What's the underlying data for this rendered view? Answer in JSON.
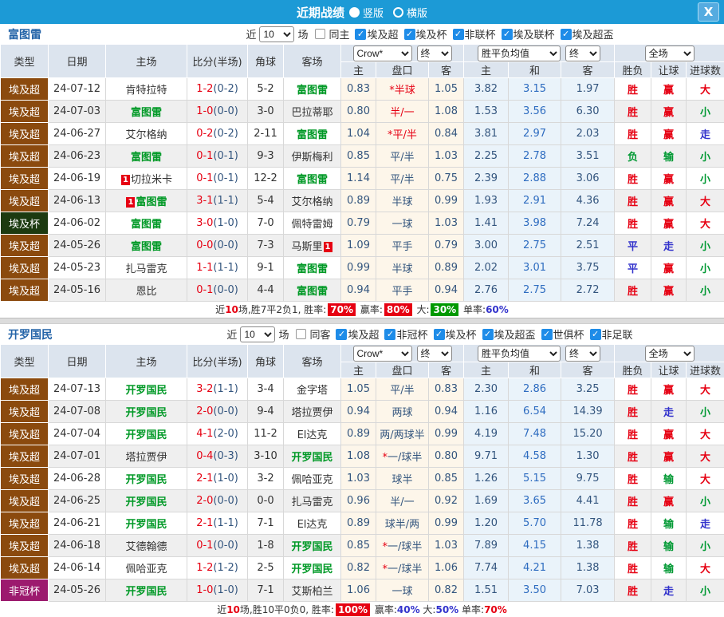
{
  "titlebar": {
    "title": "近期战绩",
    "radio_vertical": "竖版",
    "radio_horizontal": "横版",
    "close_label": "X"
  },
  "colors": {
    "titlebar_blue": "#1c9ad6",
    "type_league_brown": "#8b4a0e",
    "type_cup_darkgreen": "#1c3a10",
    "type_cup_purple": "#9c1a6e",
    "win_red": "#e60012",
    "lose_green": "#009933",
    "draw_blue": "#3333cc",
    "focus_team_green": "#009926",
    "odds_navy": "#33557e",
    "avg_draw_blue": "#2e6cc0"
  },
  "sections": [
    {
      "team": "富图雷",
      "filters": {
        "near": "近",
        "count": "10",
        "games": "场",
        "same_label": "同主",
        "same_checked": false,
        "leagues": [
          "埃及超",
          "埃及杯",
          "非联杯",
          "埃及联杯",
          "埃及超盃"
        ]
      },
      "header": {
        "cols": [
          "类型",
          "日期",
          "主场",
          "比分(半场)",
          "角球",
          "客场"
        ],
        "crow_select": "Crow*",
        "final_select1": "终",
        "avg_select": "胜平负均值",
        "final_select2": "终",
        "full_select": "全场",
        "sub_cols": [
          "主",
          "盘口",
          "客",
          "主",
          "和",
          "客",
          "胜负",
          "让球",
          "进球数"
        ]
      },
      "rows": [
        {
          "type": "埃及超",
          "type_color": "brown",
          "date": "24-07-12",
          "home": "肯特拉特",
          "home_green": false,
          "home_badge": "",
          "score": "1-2",
          "half": "(0-2)",
          "corner": "5-2",
          "away": "富图雷",
          "away_green": true,
          "away_badge": "",
          "crow_home": "0.83",
          "hcp_star": true,
          "hcp": "半球",
          "hcp_color": "red",
          "crow_away": "1.05",
          "avg_home": "3.82",
          "avg_draw": "3.15",
          "avg_away": "1.97",
          "res": "胜",
          "res_color": "red",
          "let": "赢",
          "let_color": "red",
          "goal": "大",
          "goal_color": "red"
        },
        {
          "type": "埃及超",
          "type_color": "brown",
          "date": "24-07-03",
          "home": "富图雷",
          "home_green": true,
          "home_badge": "",
          "score": "1-0",
          "half": "(0-0)",
          "corner": "3-0",
          "away": "巴拉蒂耶",
          "away_green": false,
          "away_badge": "",
          "crow_home": "0.80",
          "hcp_star": false,
          "hcp": "半/一",
          "hcp_color": "red",
          "crow_away": "1.08",
          "avg_home": "1.53",
          "avg_draw": "3.56",
          "avg_away": "6.30",
          "res": "胜",
          "res_color": "red",
          "let": "赢",
          "let_color": "red",
          "goal": "小",
          "goal_color": "green"
        },
        {
          "type": "埃及超",
          "type_color": "brown",
          "date": "24-06-27",
          "home": "艾尔格纳",
          "home_green": false,
          "home_badge": "",
          "score": "0-2",
          "half": "(0-2)",
          "corner": "2-11",
          "away": "富图雷",
          "away_green": true,
          "away_badge": "",
          "crow_home": "1.04",
          "hcp_star": true,
          "hcp": "平/半",
          "hcp_color": "red",
          "crow_away": "0.84",
          "avg_home": "3.81",
          "avg_draw": "2.97",
          "avg_away": "2.03",
          "res": "胜",
          "res_color": "red",
          "let": "赢",
          "let_color": "red",
          "goal": "走",
          "goal_color": "blue"
        },
        {
          "type": "埃及超",
          "type_color": "brown",
          "date": "24-06-23",
          "home": "富图雷",
          "home_green": true,
          "home_badge": "",
          "score": "0-1",
          "half": "(0-1)",
          "corner": "9-3",
          "away": "伊斯梅利",
          "away_green": false,
          "away_badge": "",
          "crow_home": "0.85",
          "hcp_star": false,
          "hcp": "平/半",
          "hcp_color": "navy",
          "crow_away": "1.03",
          "avg_home": "2.25",
          "avg_draw": "2.78",
          "avg_away": "3.51",
          "res": "负",
          "res_color": "green",
          "let": "输",
          "let_color": "green",
          "goal": "小",
          "goal_color": "green"
        },
        {
          "type": "埃及超",
          "type_color": "brown",
          "date": "24-06-19",
          "home": "切拉米卡",
          "home_green": false,
          "home_badge": "pre",
          "score": "0-1",
          "half": "(0-1)",
          "corner": "12-2",
          "away": "富图雷",
          "away_green": true,
          "away_badge": "",
          "crow_home": "1.14",
          "hcp_star": false,
          "hcp": "平/半",
          "hcp_color": "navy",
          "crow_away": "0.75",
          "avg_home": "2.39",
          "avg_draw": "2.88",
          "avg_away": "3.06",
          "res": "胜",
          "res_color": "red",
          "let": "赢",
          "let_color": "red",
          "goal": "小",
          "goal_color": "green"
        },
        {
          "type": "埃及超",
          "type_color": "brown",
          "date": "24-06-13",
          "home": "富图雷",
          "home_green": true,
          "home_badge": "pre",
          "score": "3-1",
          "half": "(1-1)",
          "corner": "5-4",
          "away": "艾尔格纳",
          "away_green": false,
          "away_badge": "",
          "crow_home": "0.89",
          "hcp_star": false,
          "hcp": "半球",
          "hcp_color": "navy",
          "crow_away": "0.99",
          "avg_home": "1.93",
          "avg_draw": "2.91",
          "avg_away": "4.36",
          "res": "胜",
          "res_color": "red",
          "let": "赢",
          "let_color": "red",
          "goal": "大",
          "goal_color": "red"
        },
        {
          "type": "埃及杯",
          "type_color": "darkgreen",
          "date": "24-06-02",
          "home": "富图雷",
          "home_green": true,
          "home_badge": "",
          "score": "3-0",
          "half": "(1-0)",
          "corner": "7-0",
          "away": "佩特雷姆",
          "away_green": false,
          "away_badge": "",
          "crow_home": "0.79",
          "hcp_star": false,
          "hcp": "一球",
          "hcp_color": "navy",
          "crow_away": "1.03",
          "avg_home": "1.41",
          "avg_draw": "3.98",
          "avg_away": "7.24",
          "res": "胜",
          "res_color": "red",
          "let": "赢",
          "let_color": "red",
          "goal": "大",
          "goal_color": "red"
        },
        {
          "type": "埃及超",
          "type_color": "brown",
          "date": "24-05-26",
          "home": "富图雷",
          "home_green": true,
          "home_badge": "",
          "score": "0-0",
          "half": "(0-0)",
          "corner": "7-3",
          "away": "马斯里",
          "away_green": false,
          "away_badge": "post",
          "crow_home": "1.09",
          "hcp_star": false,
          "hcp": "平手",
          "hcp_color": "navy",
          "crow_away": "0.79",
          "avg_home": "3.00",
          "avg_draw": "2.75",
          "avg_away": "2.51",
          "res": "平",
          "res_color": "blue",
          "let": "走",
          "let_color": "blue",
          "goal": "小",
          "goal_color": "green"
        },
        {
          "type": "埃及超",
          "type_color": "brown",
          "date": "24-05-23",
          "home": "扎马雷克",
          "home_green": false,
          "home_badge": "",
          "score": "1-1",
          "half": "(1-1)",
          "corner": "9-1",
          "away": "富图雷",
          "away_green": true,
          "away_badge": "",
          "crow_home": "0.99",
          "hcp_star": false,
          "hcp": "半球",
          "hcp_color": "navy",
          "crow_away": "0.89",
          "avg_home": "2.02",
          "avg_draw": "3.01",
          "avg_away": "3.75",
          "res": "平",
          "res_color": "blue",
          "let": "赢",
          "let_color": "red",
          "goal": "小",
          "goal_color": "green"
        },
        {
          "type": "埃及超",
          "type_color": "brown",
          "date": "24-05-16",
          "home": "恩比",
          "home_green": false,
          "home_badge": "",
          "score": "0-1",
          "half": "(0-0)",
          "corner": "4-4",
          "away": "富图雷",
          "away_green": true,
          "away_badge": "",
          "crow_home": "0.94",
          "hcp_star": false,
          "hcp": "平手",
          "hcp_color": "navy",
          "crow_away": "0.94",
          "avg_home": "2.76",
          "avg_draw": "2.75",
          "avg_away": "2.72",
          "res": "胜",
          "res_color": "red",
          "let": "赢",
          "let_color": "red",
          "goal": "小",
          "goal_color": "green"
        }
      ],
      "summary": [
        {
          "t": "近",
          "s": "plain"
        },
        {
          "t": "10",
          "s": "red-text"
        },
        {
          "t": "场,胜7平2负1, 胜率:",
          "s": "plain"
        },
        {
          "t": "70%",
          "s": "red-badge"
        },
        {
          "t": " 赢率:",
          "s": "plain"
        },
        {
          "t": "80%",
          "s": "red-badge"
        },
        {
          "t": " 大:",
          "s": "plain"
        },
        {
          "t": "30%",
          "s": "green-badge"
        },
        {
          "t": " 单率:",
          "s": "plain"
        },
        {
          "t": "60%",
          "s": "blue-text"
        }
      ]
    },
    {
      "team": "开罗国民",
      "filters": {
        "near": "近",
        "count": "10",
        "games": "场",
        "same_label": "同客",
        "same_checked": false,
        "leagues": [
          "埃及超",
          "非冠杯",
          "埃及杯",
          "埃及超盃",
          "世俱杯",
          "非足联"
        ]
      },
      "header": {
        "cols": [
          "类型",
          "日期",
          "主场",
          "比分(半场)",
          "角球",
          "客场"
        ],
        "crow_select": "Crow*",
        "final_select1": "终",
        "avg_select": "胜平负均值",
        "final_select2": "终",
        "full_select": "全场",
        "sub_cols": [
          "主",
          "盘口",
          "客",
          "主",
          "和",
          "客",
          "胜负",
          "让球",
          "进球数"
        ]
      },
      "rows": [
        {
          "type": "埃及超",
          "type_color": "brown",
          "date": "24-07-13",
          "home": "开罗国民",
          "home_green": true,
          "home_badge": "",
          "score": "3-2",
          "half": "(1-1)",
          "corner": "3-4",
          "away": "金字塔",
          "away_green": false,
          "away_badge": "",
          "crow_home": "1.05",
          "hcp_star": false,
          "hcp": "平/半",
          "hcp_color": "navy",
          "crow_away": "0.83",
          "avg_home": "2.30",
          "avg_draw": "2.86",
          "avg_away": "3.25",
          "res": "胜",
          "res_color": "red",
          "let": "赢",
          "let_color": "red",
          "goal": "大",
          "goal_color": "red"
        },
        {
          "type": "埃及超",
          "type_color": "brown",
          "date": "24-07-08",
          "home": "开罗国民",
          "home_green": true,
          "home_badge": "",
          "score": "2-0",
          "half": "(0-0)",
          "corner": "9-4",
          "away": "塔拉贾伊",
          "away_green": false,
          "away_badge": "",
          "crow_home": "0.94",
          "hcp_star": false,
          "hcp": "两球",
          "hcp_color": "navy",
          "crow_away": "0.94",
          "avg_home": "1.16",
          "avg_draw": "6.54",
          "avg_away": "14.39",
          "res": "胜",
          "res_color": "red",
          "let": "走",
          "let_color": "blue",
          "goal": "小",
          "goal_color": "green"
        },
        {
          "type": "埃及超",
          "type_color": "brown",
          "date": "24-07-04",
          "home": "开罗国民",
          "home_green": true,
          "home_badge": "",
          "score": "4-1",
          "half": "(2-0)",
          "corner": "11-2",
          "away": "El达克",
          "away_green": false,
          "away_badge": "",
          "crow_home": "0.89",
          "hcp_star": false,
          "hcp": "两/两球半",
          "hcp_color": "navy",
          "crow_away": "0.99",
          "avg_home": "4.19",
          "avg_draw": "7.48",
          "avg_away": "15.20",
          "res": "胜",
          "res_color": "red",
          "let": "赢",
          "let_color": "red",
          "goal": "大",
          "goal_color": "red"
        },
        {
          "type": "埃及超",
          "type_color": "brown",
          "date": "24-07-01",
          "home": "塔拉贾伊",
          "home_green": false,
          "home_badge": "",
          "score": "0-4",
          "half": "(0-3)",
          "corner": "3-10",
          "away": "开罗国民",
          "away_green": true,
          "away_badge": "",
          "crow_home": "1.08",
          "hcp_star": true,
          "hcp": "一/球半",
          "hcp_color": "navy",
          "crow_away": "0.80",
          "avg_home": "9.71",
          "avg_draw": "4.58",
          "avg_away": "1.30",
          "res": "胜",
          "res_color": "red",
          "let": "赢",
          "let_color": "red",
          "goal": "大",
          "goal_color": "red"
        },
        {
          "type": "埃及超",
          "type_color": "brown",
          "date": "24-06-28",
          "home": "开罗国民",
          "home_green": true,
          "home_badge": "",
          "score": "2-1",
          "half": "(1-0)",
          "corner": "3-2",
          "away": "佩哈亚克",
          "away_green": false,
          "away_badge": "",
          "crow_home": "1.03",
          "hcp_star": false,
          "hcp": "球半",
          "hcp_color": "navy",
          "crow_away": "0.85",
          "avg_home": "1.26",
          "avg_draw": "5.15",
          "avg_away": "9.75",
          "res": "胜",
          "res_color": "red",
          "let": "输",
          "let_color": "green",
          "goal": "大",
          "goal_color": "red"
        },
        {
          "type": "埃及超",
          "type_color": "brown",
          "date": "24-06-25",
          "home": "开罗国民",
          "home_green": true,
          "home_badge": "",
          "score": "2-0",
          "half": "(0-0)",
          "corner": "0-0",
          "away": "扎马雷克",
          "away_green": false,
          "away_badge": "",
          "crow_home": "0.96",
          "hcp_star": false,
          "hcp": "半/一",
          "hcp_color": "navy",
          "crow_away": "0.92",
          "avg_home": "1.69",
          "avg_draw": "3.65",
          "avg_away": "4.41",
          "res": "胜",
          "res_color": "red",
          "let": "赢",
          "let_color": "red",
          "goal": "小",
          "goal_color": "green"
        },
        {
          "type": "埃及超",
          "type_color": "brown",
          "date": "24-06-21",
          "home": "开罗国民",
          "home_green": true,
          "home_badge": "",
          "score": "2-1",
          "half": "(1-1)",
          "corner": "7-1",
          "away": "El达克",
          "away_green": false,
          "away_badge": "",
          "crow_home": "0.89",
          "hcp_star": false,
          "hcp": "球半/两",
          "hcp_color": "navy",
          "crow_away": "0.99",
          "avg_home": "1.20",
          "avg_draw": "5.70",
          "avg_away": "11.78",
          "res": "胜",
          "res_color": "red",
          "let": "输",
          "let_color": "green",
          "goal": "走",
          "goal_color": "blue"
        },
        {
          "type": "埃及超",
          "type_color": "brown",
          "date": "24-06-18",
          "home": "艾德翰德",
          "home_green": false,
          "home_badge": "",
          "score": "0-1",
          "half": "(0-0)",
          "corner": "1-8",
          "away": "开罗国民",
          "away_green": true,
          "away_badge": "",
          "crow_home": "0.85",
          "hcp_star": true,
          "hcp": "一/球半",
          "hcp_color": "navy",
          "crow_away": "1.03",
          "avg_home": "7.89",
          "avg_draw": "4.15",
          "avg_away": "1.38",
          "res": "胜",
          "res_color": "red",
          "let": "输",
          "let_color": "green",
          "goal": "小",
          "goal_color": "green"
        },
        {
          "type": "埃及超",
          "type_color": "brown",
          "date": "24-06-14",
          "home": "佩哈亚克",
          "home_green": false,
          "home_badge": "",
          "score": "1-2",
          "half": "(1-2)",
          "corner": "2-5",
          "away": "开罗国民",
          "away_green": true,
          "away_badge": "",
          "crow_home": "0.82",
          "hcp_star": true,
          "hcp": "一/球半",
          "hcp_color": "navy",
          "crow_away": "1.06",
          "avg_home": "7.74",
          "avg_draw": "4.21",
          "avg_away": "1.38",
          "res": "胜",
          "res_color": "red",
          "let": "输",
          "let_color": "green",
          "goal": "大",
          "goal_color": "red"
        },
        {
          "type": "非冠杯",
          "type_color": "purple",
          "date": "24-05-26",
          "home": "开罗国民",
          "home_green": true,
          "home_badge": "",
          "score": "1-0",
          "half": "(1-0)",
          "corner": "7-1",
          "away": "艾斯柏兰",
          "away_green": false,
          "away_badge": "",
          "crow_home": "1.06",
          "hcp_star": false,
          "hcp": "一球",
          "hcp_color": "navy",
          "crow_away": "0.82",
          "avg_home": "1.51",
          "avg_draw": "3.50",
          "avg_away": "7.03",
          "res": "胜",
          "res_color": "red",
          "let": "走",
          "let_color": "blue",
          "goal": "小",
          "goal_color": "green"
        }
      ],
      "summary": [
        {
          "t": "近",
          "s": "plain"
        },
        {
          "t": "10",
          "s": "red-text"
        },
        {
          "t": "场,胜10平0负0, 胜率:",
          "s": "plain"
        },
        {
          "t": "100%",
          "s": "red-badge"
        },
        {
          "t": " 赢率:",
          "s": "plain"
        },
        {
          "t": "40%",
          "s": "blue-text"
        },
        {
          "t": " 大:",
          "s": "plain"
        },
        {
          "t": "50%",
          "s": "blue-text"
        },
        {
          "t": " 单率:",
          "s": "plain"
        },
        {
          "t": "70%",
          "s": "red-text"
        }
      ]
    }
  ]
}
